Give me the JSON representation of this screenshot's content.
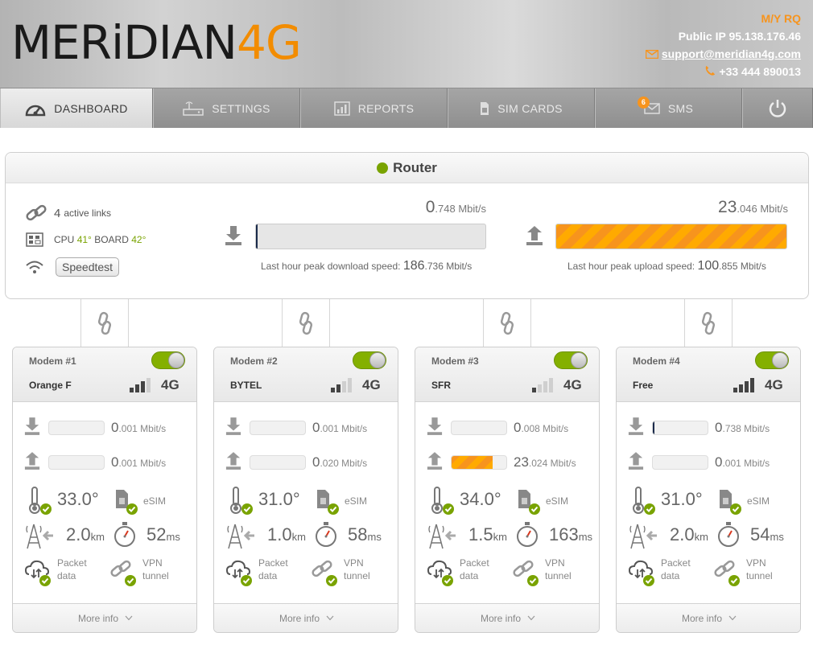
{
  "header": {
    "logo_text": "MERiDIAN",
    "logo_suffix": "4G",
    "vessel": "M/Y RQ",
    "public_ip": "Public IP 95.138.176.46",
    "email": "support@meridian4g.com",
    "phone": "+33 444 890013"
  },
  "nav": {
    "tabs": [
      {
        "label": "DASHBOARD",
        "icon": "gauge-icon",
        "active": true
      },
      {
        "label": "SETTINGS",
        "icon": "router-icon"
      },
      {
        "label": "REPORTS",
        "icon": "chart-icon"
      },
      {
        "label": "SIM CARDS",
        "icon": "sim-icon"
      },
      {
        "label": "SMS",
        "icon": "envelope-icon",
        "badge": "6"
      },
      {
        "label": "",
        "icon": "power-icon"
      }
    ]
  },
  "router": {
    "title": "Router",
    "status_color": "#79a300",
    "links_count": "4",
    "links_label": "active links",
    "cpu_label": "CPU",
    "cpu_temp": "41°",
    "board_label": "BOARD",
    "board_temp": "42°",
    "speedtest_label": "Speedtest",
    "download": {
      "int": "0",
      "dec": ".748 Mbit/s",
      "level": 0.005
    },
    "upload": {
      "int": "23",
      "dec": ".046 Mbit/s",
      "level": 1.0
    },
    "download_peak": {
      "label": "Last hour peak download speed:",
      "int": "186",
      "dec": ".736 Mbit/s"
    },
    "upload_peak": {
      "label": "Last hour peak upload speed:",
      "int": "100",
      "dec": ".855 Mbit/s"
    }
  },
  "modems": [
    {
      "name": "Modem #1",
      "carrier": "Orange F",
      "signal": 3,
      "network": "4G",
      "down": {
        "int": "0",
        "dec": ".001 Mbit/s",
        "level": 0
      },
      "up": {
        "int": "0",
        "dec": ".001 Mbit/s",
        "level": 0
      },
      "temp": "33.0°",
      "sim": "eSIM",
      "dist": "2.0",
      "dist_unit": "km",
      "ping": "52",
      "ping_unit": "ms",
      "packet": "Packet data",
      "vpn": "VPN tunnel",
      "more": "More info"
    },
    {
      "name": "Modem #2",
      "carrier": "BYTEL",
      "signal": 2,
      "network": "4G",
      "down": {
        "int": "0",
        "dec": ".001 Mbit/s",
        "level": 0
      },
      "up": {
        "int": "0",
        "dec": ".020 Mbit/s",
        "level": 0
      },
      "temp": "31.0°",
      "sim": "eSIM",
      "dist": "1.0",
      "dist_unit": "km",
      "ping": "58",
      "ping_unit": "ms",
      "packet": "Packet data",
      "vpn": "VPN tunnel",
      "more": "More info"
    },
    {
      "name": "Modem #3",
      "carrier": "SFR",
      "signal": 1,
      "network": "4G",
      "down": {
        "int": "0",
        "dec": ".008 Mbit/s",
        "level": 0
      },
      "up": {
        "int": "23",
        "dec": ".024 Mbit/s",
        "level": 0.75
      },
      "temp": "34.0°",
      "sim": "eSIM",
      "dist": "1.5",
      "dist_unit": "km",
      "ping": "163",
      "ping_unit": "ms",
      "packet": "Packet data",
      "vpn": "VPN tunnel",
      "more": "More info"
    },
    {
      "name": "Modem #4",
      "carrier": "Free",
      "signal": 4,
      "network": "4G",
      "down": {
        "int": "0",
        "dec": ".738 Mbit/s",
        "level": 0.01
      },
      "up": {
        "int": "0",
        "dec": ".001 Mbit/s",
        "level": 0
      },
      "temp": "31.0°",
      "sim": "eSIM",
      "dist": "2.0",
      "dist_unit": "km",
      "ping": "54",
      "ping_unit": "ms",
      "packet": "Packet data",
      "vpn": "VPN tunnel",
      "more": "More info"
    }
  ]
}
